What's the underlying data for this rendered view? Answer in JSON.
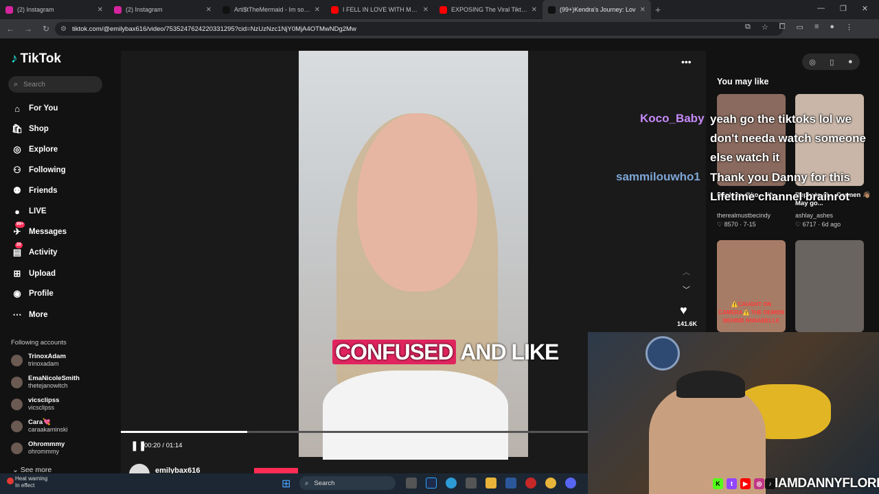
{
  "browser": {
    "tabs": [
      {
        "title": "(2) Instagram",
        "color": "#d6249f",
        "active": false
      },
      {
        "title": "(2) Instagram",
        "color": "#d6249f",
        "active": false
      },
      {
        "title": "Arti$tTheMermaid - Im so sick o",
        "color": "#111111",
        "active": false
      },
      {
        "title": "I FELL IN LOVE WITH MY PSYCH",
        "color": "#ff0000",
        "active": false
      },
      {
        "title": "EXPOSING The Viral Tiktoker W",
        "color": "#ff0000",
        "active": false
      },
      {
        "title": "(99+)Kendra's Journey: Lov",
        "color": "#111111",
        "active": true
      }
    ],
    "url": "tiktok.com/@emilybax616/video/7535247624220331295?cid=NzUzNzc1NjY0MjA4OTMwNDg2Mw"
  },
  "tiktok": {
    "logo": "TikTok",
    "search_placeholder": "Search",
    "nav": [
      {
        "label": "For You",
        "icon": "home-icon"
      },
      {
        "label": "Shop",
        "icon": "shop-icon"
      },
      {
        "label": "Explore",
        "icon": "compass-icon"
      },
      {
        "label": "Following",
        "icon": "following-icon"
      },
      {
        "label": "Friends",
        "icon": "friends-icon"
      },
      {
        "label": "LIVE",
        "icon": "live-icon"
      },
      {
        "label": "Messages",
        "icon": "messages-icon",
        "badge": "99+"
      },
      {
        "label": "Activity",
        "icon": "activity-icon",
        "badge": "20"
      },
      {
        "label": "Upload",
        "icon": "upload-icon"
      },
      {
        "label": "Profile",
        "icon": "profile-icon"
      },
      {
        "label": "More",
        "icon": "more-icon"
      }
    ],
    "following_title": "Following accounts",
    "accounts": [
      {
        "name": "TrinoxAdam",
        "handle": "trinoxadam"
      },
      {
        "name": "EmaNicoleSmith",
        "handle": "thetejanowitch"
      },
      {
        "name": "vicsclipss",
        "handle": "vicsclipss"
      },
      {
        "name": "Cara💘",
        "handle": "caraakaminski"
      },
      {
        "name": "Ohrommmy",
        "handle": "ohrommmy"
      }
    ],
    "see_more": "See more",
    "video": {
      "caption_highlight": "CONFUSED",
      "caption_rest": "AND LIKE",
      "time": "00:20 / 01:14",
      "progress": 0.27,
      "author": "emilybax616",
      "likes": "141.6K"
    },
    "you_may_like": {
      "title": "You may like",
      "items": [
        {
          "caption": "Reply to @ko... #fy...",
          "user": "therealmustbecindy",
          "meta": "8570 · 7-15",
          "color": "#8a6a5e"
        },
        {
          "caption": "Reply to @... Carmen 👋🏽 May go...",
          "user": "ashlay_ashes",
          "meta": "6717 · 6d ago",
          "color": "#c9b6a8"
        },
        {
          "caption": "⚠️CAUGHT ON CAMERA⚠️ THE DEMON BEHIND ANNABELLE",
          "user": "",
          "meta": "",
          "color": "#a77c66"
        },
        {
          "caption": "",
          "user": "",
          "meta": "",
          "color": "#6a6460"
        }
      ]
    }
  },
  "stream": {
    "chat": [
      {
        "name": "Koco_Baby",
        "color": "#c58af9",
        "lines": [
          "yeah go the tiktoks lol we",
          "don't needa watch someone",
          "else watch it"
        ]
      },
      {
        "name": "sammilouwho1",
        "color": "#7ea6d6",
        "lines": [
          "Thank you Danny for this",
          "Lifetime channel brainrot"
        ]
      }
    ],
    "handle": "IAMDANNYFLORES"
  },
  "taskbar": {
    "heat_line1": "Heat warning",
    "heat_line2": "In effect",
    "search_placeholder": "Search"
  }
}
